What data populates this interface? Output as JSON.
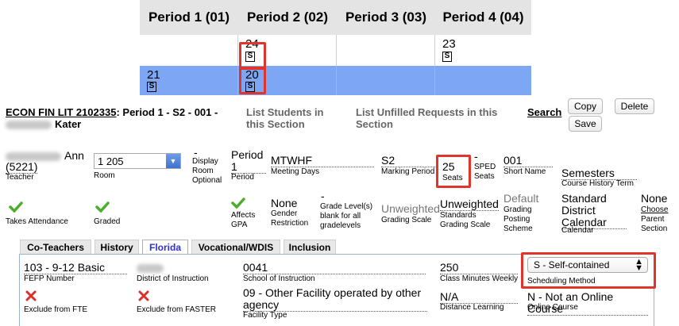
{
  "periods": [
    "Period 1 (01)",
    "Period 2 (02)",
    "Period 3 (03)",
    "Period 4 (04)"
  ],
  "grid_rows": [
    {
      "cells": [
        {
          "count": ""
        },
        {
          "count": "24",
          "badge": "S"
        },
        {
          "count": ""
        },
        {
          "count": "23",
          "badge": "S"
        }
      ]
    },
    {
      "cells": [
        {
          "count": "21",
          "badge": "S"
        },
        {
          "count": "20",
          "badge": "S"
        },
        {
          "count": ""
        },
        {
          "count": ""
        }
      ]
    }
  ],
  "section": {
    "course_link": "ECON FIN LIT 2102335",
    "title_rest": ": Period 1 - S2 - 001 -",
    "teacher_last": "Kater",
    "list_students": "List Students in this Section",
    "list_unfilled": "List Unfilled Requests in this Section",
    "search": "Search",
    "copy": "Copy",
    "delete": "Delete",
    "save": "Save"
  },
  "fields": {
    "teacher_name": "Ann",
    "teacher_id": "(5221)",
    "teacher_label": "Teacher",
    "room_value": "1 205",
    "room_label": "Room",
    "display_room_dash": "-",
    "display_room_label": "Display Room Optional",
    "period_value": "Period 1",
    "period_label": "Period",
    "days_value": "MTWHF",
    "days_label": "Meeting Days",
    "marking_value": "S2",
    "marking_label": "Marking Period",
    "seats_value": "25",
    "seats_label": "Seats",
    "sped_dash": "-",
    "sped_label": "SPED Seats",
    "short_value": "001",
    "short_label": "Short Name",
    "history_value": "Semesters",
    "history_label": "Course History Term",
    "takes_attendance": "Takes Attendance",
    "graded": "Graded",
    "affects_gpa": "Affects GPA",
    "gender_value": "None",
    "gender_label": "Gender Restriction",
    "grade_dash": "-",
    "grade_label": "Grade Level(s) blank for all gradelevels",
    "grading_scale_value": "Unweighted",
    "grading_scale_label": "Grading Scale",
    "standards_value": "Unweighted",
    "standards_label": "Standards Grading Scale",
    "posting_value": "Default",
    "posting_label": "Grading Posting Scheme",
    "calendar_value": "Standard District Calendar",
    "calendar_label": "Calendar",
    "parent_value": "None",
    "parent_choose": "Choose",
    "parent_label": "Parent Section"
  },
  "tabs": [
    "Co-Teachers",
    "History",
    "Florida",
    "Vocational/WDIS",
    "Inclusion"
  ],
  "florida": {
    "fefp_value": "103 - 9-12 Basic",
    "fefp_label": "FEFP Number",
    "district_label": "District of Instruction",
    "school_value": "0041",
    "school_label": "School of Instruction",
    "minutes_value": "250",
    "minutes_label": "Class Minutes Weekly",
    "scheduling_value": "S - Self-contained",
    "scheduling_label": "Scheduling Method",
    "exclude_fte": "Exclude from FTE",
    "exclude_faster": "Exclude from FASTER",
    "facility_value": "09 - Other Facility operated by other agency",
    "facility_label": "Facility Type",
    "distance_value": "N/A",
    "distance_label": "Distance Learning",
    "online_value": "N - Not an Online Course",
    "online_label": "Online Course"
  },
  "colors": {
    "highlight_row": "#7da7f5",
    "callout": "#e0352b",
    "check_green": "#4cae2a",
    "x_red": "#d9302b",
    "tab_active": "#3030d0"
  }
}
